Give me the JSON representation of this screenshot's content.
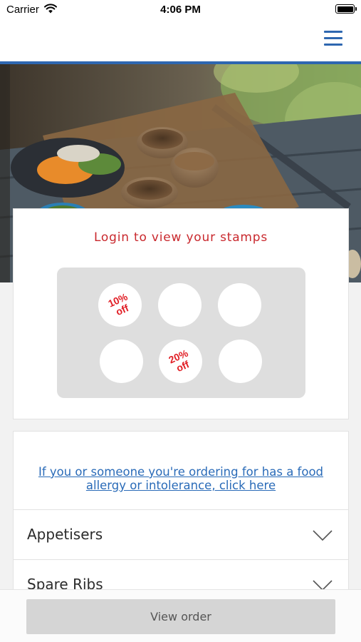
{
  "status_bar": {
    "carrier": "Carrier",
    "time": "4:06 PM",
    "icons": [
      "wifi-icon",
      "battery-icon"
    ]
  },
  "header": {
    "menu_icon": "hamburger-menu-icon",
    "accent_color": "#2e67b0"
  },
  "hero": {
    "image": "food-bowls-photo"
  },
  "stamp_card": {
    "login_text": "Login to view your stamps",
    "stamps": [
      {
        "label": "10%\noff"
      },
      {
        "label": ""
      },
      {
        "label": ""
      },
      {
        "label": ""
      },
      {
        "label": "20%\noff"
      },
      {
        "label": ""
      }
    ],
    "text_color": "#c9282d"
  },
  "menu": {
    "allergy_link": "If you or someone you're ordering for has a food allergy or intolerance, click here",
    "categories": [
      {
        "label": "Appetisers",
        "icon": "chevron-down-icon"
      },
      {
        "label": "Spare Ribs",
        "icon": "chevron-down-icon"
      }
    ],
    "link_color": "#2a6bb8"
  },
  "bottom_bar": {
    "view_order_label": "View order"
  }
}
